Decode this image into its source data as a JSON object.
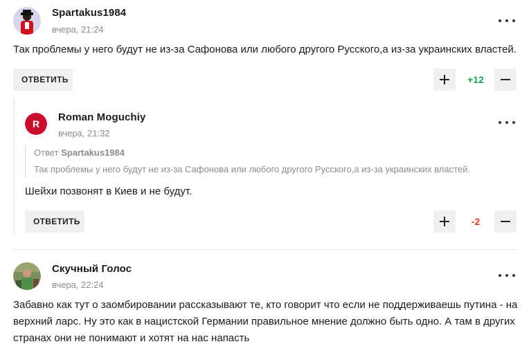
{
  "comments": [
    {
      "author": "Spartakus1984",
      "time": "вчера, 21:24",
      "text": "Так проблемы у него будут не из-за Сафонова или любого другого Русского,а из-за украинских властей.",
      "reply_label": "ОТВЕТИТЬ",
      "score": "+12",
      "score_color": "#1f9d55"
    },
    {
      "author": "Roman Moguchiy",
      "avatar_letter": "R",
      "avatar_color": "#c8102e",
      "time": "вчера, 21:32",
      "quote_prefix": "Ответ",
      "quote_author": "Spartakus1984",
      "quote_text": "Так проблемы у него будут не из-за Сафонова или любого другого Русского,а из-за украинских властей.",
      "text": "Шейхи позвонят в Киев и не будут.",
      "reply_label": "ОТВЕТИТЬ",
      "score": "-2",
      "score_color": "#e53935"
    },
    {
      "author": "Скучный Голос",
      "time": "вчера, 22:24",
      "text_lines": [
        "Забавно как тут о заомбировании рассказывают те, кто говорит что если не поддерживаешь путина - на",
        "верхний ларс. Ну это как в нацистской Германии правильное мнение должно быть одно. А там в других",
        "странах они не понимают и хотят на нас напасть"
      ]
    }
  ]
}
